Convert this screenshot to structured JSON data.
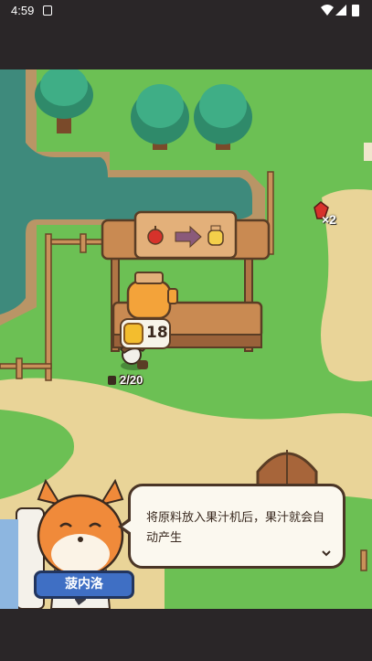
{
  "status_bar": {
    "time": "4:59"
  },
  "hud": {
    "pickup_count": "×2",
    "juice_stock": "18",
    "juicer_capacity": "2/20"
  },
  "recipe_sign": {
    "input_icon": "apple-icon",
    "output_icon": "juice-jar-icon"
  },
  "dialogue": {
    "speaker": "菠内洛",
    "message": "将原料放入果汁机后，果汁就会自动产生"
  },
  "colors": {
    "grass": "#6cc054",
    "water": "#3e8a7c",
    "path": "#e9d498",
    "wood": "#b07545",
    "nameplate": "#3f6fc4"
  }
}
